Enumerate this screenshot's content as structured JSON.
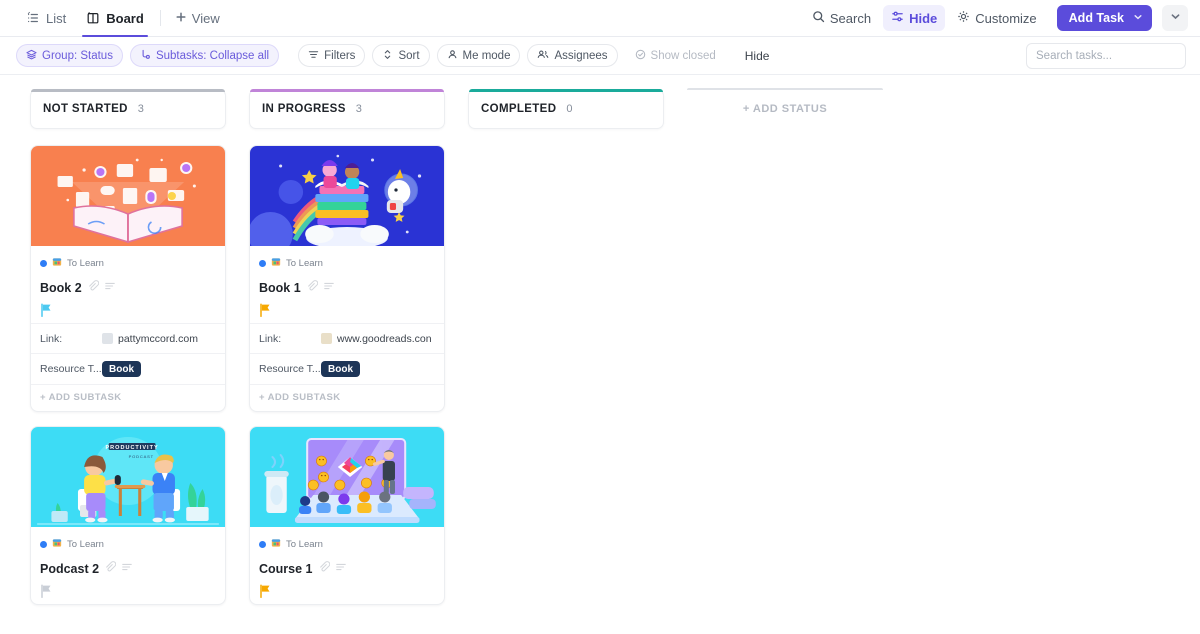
{
  "topbar": {
    "tabs": [
      {
        "label": "List",
        "icon": "list-icon",
        "active": false
      },
      {
        "label": "Board",
        "icon": "board-icon",
        "active": true
      }
    ],
    "add_view_label": "View",
    "search_label": "Search",
    "hide_label": "Hide",
    "customize_label": "Customize",
    "add_task_label": "Add Task",
    "accent_color": "#5b4cdb"
  },
  "filterbar": {
    "group_label": "Group: Status",
    "subtasks_label": "Subtasks: Collapse all",
    "filters_label": "Filters",
    "sort_label": "Sort",
    "me_mode_label": "Me mode",
    "assignees_label": "Assignees",
    "show_closed_label": "Show closed",
    "hide_label": "Hide",
    "search_placeholder": "Search tasks...",
    "search_value": "",
    "chip_color": "#6a5bdb"
  },
  "board": {
    "columns": [
      {
        "name": "NOT STARTED",
        "count": "3",
        "accent": "#b8bcc4",
        "type": "status"
      },
      {
        "name": "IN PROGRESS",
        "count": "3",
        "accent": "#c084d8",
        "type": "status"
      },
      {
        "name": "COMPLETED",
        "count": "0",
        "accent": "#1aab9b",
        "type": "status"
      },
      {
        "name": "+ ADD STATUS",
        "count": "",
        "accent": "#dfe2e7",
        "type": "add"
      }
    ],
    "cards": [
      {
        "column": 0,
        "list_name": "To Learn",
        "title": "Book 2",
        "cover": "book-icons-orange-illustration",
        "flag_color": "#4cc9f0",
        "link_label": "Link:",
        "link_value": "pattymccord.com",
        "favicon_color": "#dfe3e8",
        "field_label": "Resource T...",
        "tag": "Book",
        "add_subtask_label": "+ ADD SUBTASK"
      },
      {
        "column": 1,
        "list_name": "To Learn",
        "title": "Book 1",
        "cover": "space-books-unicorn-illustration",
        "flag_color": "#f6a800",
        "link_label": "Link:",
        "link_value": "www.goodreads.con",
        "favicon_color": "#e9dfc8",
        "field_label": "Resource T...",
        "tag": "Book",
        "add_subtask_label": "+ ADD SUBTASK"
      },
      {
        "column": 0,
        "list_name": "To Learn",
        "title": "Podcast 2",
        "cover": "productivity-podcast-illustration",
        "flag_color": "#c9ced6",
        "link_label": "",
        "link_value": "",
        "favicon_color": "",
        "field_label": "",
        "tag": "",
        "add_subtask_label": ""
      },
      {
        "column": 1,
        "list_name": "To Learn",
        "title": "Course 1",
        "cover": "online-course-laptop-illustration",
        "flag_color": "#f6a800",
        "link_label": "",
        "link_value": "",
        "favicon_color": "",
        "field_label": "",
        "tag": "",
        "add_subtask_label": ""
      }
    ]
  }
}
